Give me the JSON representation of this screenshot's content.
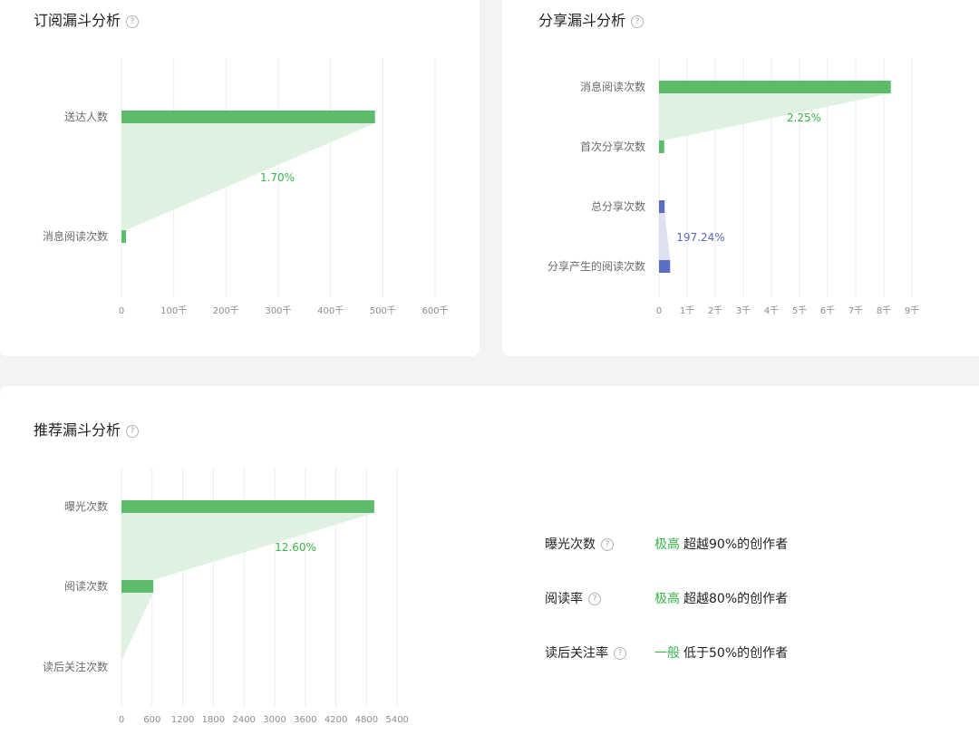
{
  "panels": {
    "subscription": {
      "title": "订阅漏斗分析"
    },
    "share": {
      "title": "分享漏斗分析"
    },
    "recommend": {
      "title": "推荐漏斗分析"
    }
  },
  "help_icon_glyph": "?",
  "colors": {
    "green": "#5dbc6a",
    "green_fill": "#dff2e1",
    "blue": "#5b6dc4",
    "blue_fill": "#dde0f0",
    "green_text": "#3ab54a"
  },
  "chart_data": [
    {
      "id": "subscription",
      "type": "bar",
      "orientation": "horizontal",
      "title": "订阅漏斗分析",
      "categories": [
        "送达人数",
        "消息阅读次数"
      ],
      "values": [
        485000,
        8250
      ],
      "xlim": [
        0,
        600000
      ],
      "x_ticks": [
        {
          "value": 0,
          "label": "0"
        },
        {
          "value": 100000,
          "label": "100千"
        },
        {
          "value": 200000,
          "label": "200千"
        },
        {
          "value": 300000,
          "label": "300千"
        },
        {
          "value": 400000,
          "label": "400千"
        },
        {
          "value": 500000,
          "label": "500千"
        },
        {
          "value": 600000,
          "label": "600千"
        }
      ],
      "links": [
        {
          "from": 0,
          "to": 1,
          "label": "1.70%",
          "color": "green"
        }
      ],
      "bar_colors": [
        "green",
        "green"
      ],
      "grid": true
    },
    {
      "id": "share",
      "type": "bar",
      "orientation": "horizontal",
      "title": "分享漏斗分析",
      "categories": [
        "消息阅读次数",
        "首次分享次数",
        "总分享次数",
        "分享产生的阅读次数"
      ],
      "values": [
        8250,
        186,
        200,
        395
      ],
      "xlim": [
        0,
        10000
      ],
      "x_ticks": [
        {
          "value": 0,
          "label": "0"
        },
        {
          "value": 1000,
          "label": "1千"
        },
        {
          "value": 2000,
          "label": "2千"
        },
        {
          "value": 3000,
          "label": "3千"
        },
        {
          "value": 4000,
          "label": "4千"
        },
        {
          "value": 5000,
          "label": "5千"
        },
        {
          "value": 6000,
          "label": "6千"
        },
        {
          "value": 7000,
          "label": "7千"
        },
        {
          "value": 8000,
          "label": "8千"
        },
        {
          "value": 9000,
          "label": "9千"
        }
      ],
      "links": [
        {
          "from": 0,
          "to": 1,
          "label": "2.25%",
          "color": "green"
        },
        {
          "from": 2,
          "to": 3,
          "label": "197.24%",
          "color": "blue"
        }
      ],
      "bar_colors": [
        "green",
        "green",
        "blue",
        "blue"
      ],
      "grid": true
    },
    {
      "id": "recommend",
      "type": "bar",
      "orientation": "horizontal",
      "title": "推荐漏斗分析",
      "categories": [
        "曝光次数",
        "阅读次数",
        "读后关注次数"
      ],
      "values": [
        4950,
        624,
        0
      ],
      "xlim": [
        0,
        6000
      ],
      "x_ticks": [
        {
          "value": 0,
          "label": "0"
        },
        {
          "value": 600,
          "label": "600"
        },
        {
          "value": 1200,
          "label": "1200"
        },
        {
          "value": 1800,
          "label": "1800"
        },
        {
          "value": 2400,
          "label": "2400"
        },
        {
          "value": 3000,
          "label": "3000"
        },
        {
          "value": 3600,
          "label": "3600"
        },
        {
          "value": 4200,
          "label": "4200"
        },
        {
          "value": 4800,
          "label": "4800"
        },
        {
          "value": 5400,
          "label": "5400"
        }
      ],
      "links": [
        {
          "from": 0,
          "to": 1,
          "label": "12.60%",
          "color": "green"
        },
        {
          "from": 1,
          "to": 2,
          "label": "",
          "color": "green"
        }
      ],
      "bar_colors": [
        "green",
        "green",
        "green"
      ],
      "grid": true
    }
  ],
  "metrics": [
    {
      "label": "曝光次数",
      "level": "极高",
      "desc": "超越90%的创作者"
    },
    {
      "label": "阅读率",
      "level": "极高",
      "desc": "超越80%的创作者"
    },
    {
      "label": "读后关注率",
      "level": "一般",
      "desc": "低于50%的创作者"
    }
  ]
}
